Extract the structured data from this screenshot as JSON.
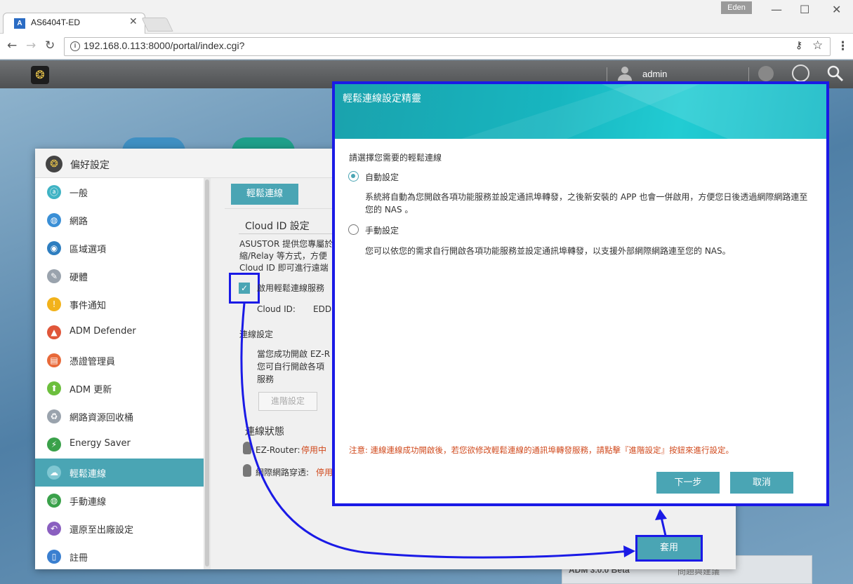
{
  "browser": {
    "tab_title": "AS6404T-ED",
    "favicon_text": "A",
    "profile": "Eden",
    "url": "192.168.0.113:8000/portal/index.cgi?"
  },
  "adm": {
    "user": "admin",
    "version": "ADM 3.0.0 Beta",
    "feedback": "問題與建議"
  },
  "preferences": {
    "title": "偏好設定",
    "sidebar": [
      {
        "label": "一般",
        "icon": "general-icon",
        "color": "#3fb3c4"
      },
      {
        "label": "網路",
        "icon": "network-globe-icon",
        "color": "#3a8fd6"
      },
      {
        "label": "區域選項",
        "icon": "region-icon",
        "color": "#2e7ec0"
      },
      {
        "label": "硬體",
        "icon": "hardware-icon",
        "color": "#9aa3ad"
      },
      {
        "label": "事件通知",
        "icon": "alert-icon",
        "color": "#f2b21b"
      },
      {
        "label": "ADM Defender",
        "icon": "firewall-icon",
        "color": "#e0563a"
      },
      {
        "label": "憑證管理員",
        "icon": "certificate-icon",
        "color": "#e86a3a"
      },
      {
        "label": "ADM 更新",
        "icon": "update-arrow-icon",
        "color": "#6cbf3d"
      },
      {
        "label": "網路資源回收桶",
        "icon": "recycle-bin-icon",
        "color": "#9aa3ad"
      },
      {
        "label": "Energy Saver",
        "icon": "energy-icon",
        "color": "#3aa14a"
      },
      {
        "label": "輕鬆連線",
        "icon": "cloud-icon",
        "color": "#7fc7d2"
      },
      {
        "label": "手動連線",
        "icon": "manual-connect-icon",
        "color": "#3aa14a"
      },
      {
        "label": "還原至出廠設定",
        "icon": "restore-icon",
        "color": "#8a5fc0"
      },
      {
        "label": "註冊",
        "icon": "register-icon",
        "color": "#3a7fd0"
      }
    ],
    "active_index": 10,
    "tab_label": "輕鬆連線",
    "cloud_id_heading": "Cloud ID 設定",
    "cloud_desc_lines": [
      "ASUSTOR 提供您專屬於",
      "縮/Relay 等方式，方便",
      "Cloud ID 即可進行遠端"
    ],
    "enable_label": "啟用輕鬆連線服務",
    "cloud_id_label": "Cloud ID:",
    "cloud_id_value": "EDD",
    "conn_settings_label": "連線設定",
    "conn_desc_lines": [
      "當您成功開啟 EZ-R",
      "您可自行開啟各項",
      "服務"
    ],
    "advanced_button": "進階設定",
    "conn_status_heading": "連線狀態",
    "ez_router_label": "EZ-Router:",
    "ez_router_status": "停用中",
    "nat_label": "網際網路穿透:",
    "nat_status": "停用",
    "apply_button": "套用"
  },
  "wizard": {
    "title": "輕鬆連線設定精靈",
    "prompt": "請選擇您需要的輕鬆連線",
    "option_auto": "自動設定",
    "option_auto_desc": "系統將自動為您開啟各項功能服務並設定通訊埠轉發，之後新安裝的 APP 也會一併啟用，方便您日後透過網際網路連至您的 NAS 。",
    "option_manual": "手動設定",
    "option_manual_desc": "您可以依您的需求自行開啟各項功能服務並設定通訊埠轉發，以支援外部網際網路連至您的 NAS。",
    "note": "注意: 連線連線成功開啟後，若您欲修改輕鬆連線的通訊埠轉發服務，請點擊『進階設定』按鈕來進行設定。",
    "next_button": "下一步",
    "cancel_button": "取消"
  },
  "colors": {
    "accent": "#4aa5b4",
    "highlight": "#1a1ae6",
    "warning": "#d0491c"
  }
}
